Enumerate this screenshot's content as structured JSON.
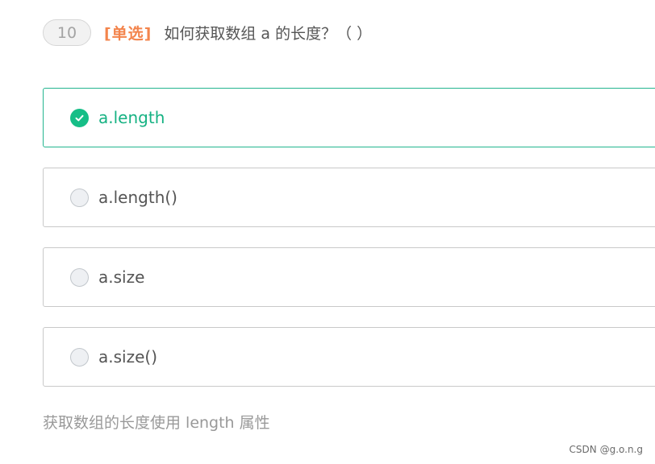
{
  "question": {
    "number": "10",
    "type": "[单选]",
    "text": "如何获取数组 a 的长度？（ ）"
  },
  "options": [
    {
      "label": "a.length",
      "selected": true
    },
    {
      "label": "a.length()",
      "selected": false
    },
    {
      "label": "a.size",
      "selected": false
    },
    {
      "label": "a.size()",
      "selected": false
    }
  ],
  "explanation": "获取数组的长度使用 length 属性",
  "watermark": "CSDN @g.o.n.g",
  "icons": {
    "selected_radio": "check-circle-icon",
    "unselected_radio": "radio-circle-icon"
  },
  "colors": {
    "accent": "#16be87",
    "type_tag": "#f3844c",
    "selected_border": "#23b58f"
  }
}
